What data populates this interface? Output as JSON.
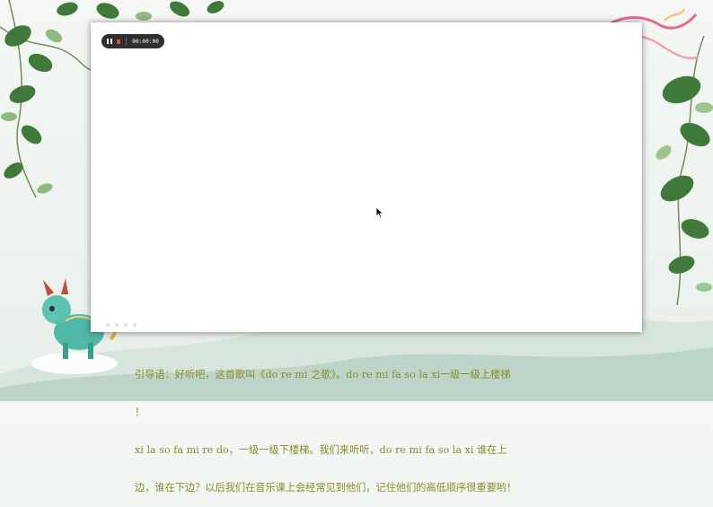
{
  "recorder": {
    "timer": "00:00:00"
  },
  "caption": {
    "line1": "引导语：好听吧，这首歌叫《do re mi 之歌》。do re mi fa so la xi一级一级上楼梯",
    "line2": "！",
    "line3": "xi la so fa mi re do，一级一级下楼梯。我们来听听，do re mi fa so la xi 谁在上",
    "line4": "边，谁在下边？以后我们在音乐课上会经常见到他们，记住他们的高低顺序很重要哟！"
  },
  "colors": {
    "caption": "#8a8b2a",
    "recorder_bg": "#2f2f33",
    "stop": "#e24a4a"
  },
  "icons": [
    "pause-icon",
    "stop-icon",
    "cursor-icon",
    "phoenix-illustration",
    "qilin-illustration",
    "vine-leaves-decoration"
  ]
}
